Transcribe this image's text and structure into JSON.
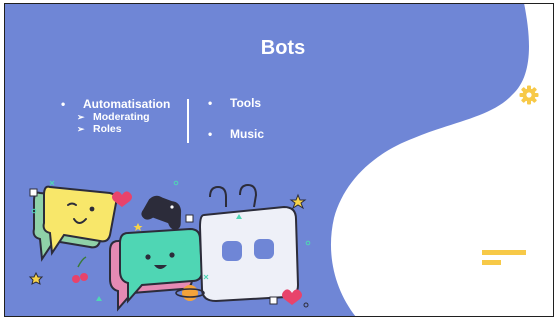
{
  "slide": {
    "title": "Bots",
    "left_column": {
      "items": [
        {
          "label": "Automatisation",
          "subitems": [
            "Moderating",
            "Roles"
          ]
        }
      ]
    },
    "right_column": {
      "items": [
        {
          "label": "Tools"
        },
        {
          "label": "Music"
        }
      ]
    },
    "bullet_glyph": "•",
    "sub_bullet_glyph": "➢"
  },
  "colors": {
    "background_blue": "#6f86d6",
    "white_shape": "#ffffff",
    "accent_yellow": "#f7c948",
    "text": "#ffffff"
  },
  "icons": {
    "gear": "gear-icon",
    "decorative_lines": "lines-icon",
    "illustration": "chat-bubbles-bot-illustration"
  }
}
